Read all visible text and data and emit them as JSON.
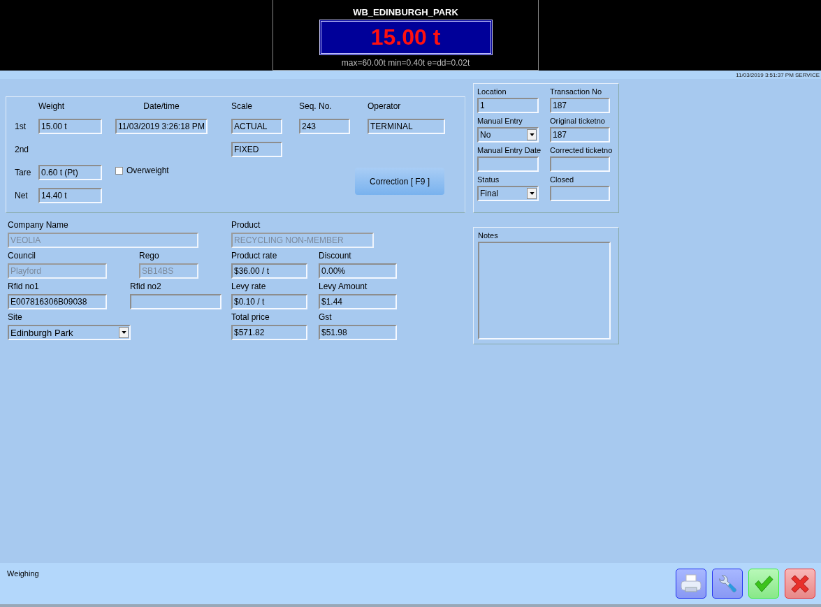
{
  "display": {
    "title": "WB_EDINBURGH_PARK",
    "weight": "15.00 t",
    "limits": "max=60.00t min=0.40t e=dd=0.02t"
  },
  "timestamp": "11/03/2019 3:51:37 PM  SERVICE",
  "weighing": {
    "headers": [
      "Weight",
      "Date/time",
      "Scale",
      "Seq. No.",
      "Operator"
    ],
    "first": {
      "label": "1st",
      "weight": "15.00  t",
      "datetime": "11/03/2019 3:26:18 PM",
      "scale": "ACTUAL",
      "seq": "243",
      "operator": "TERMINAL"
    },
    "second": {
      "label": "2nd",
      "scale": "FIXED"
    },
    "tare": {
      "label": "Tare",
      "value": "0.60  t (Pt)"
    },
    "overweight": {
      "label": "Overweight",
      "checked": false
    },
    "net": {
      "label": "Net",
      "value": "14.40  t"
    },
    "correction_button": "Correction  [ F9 ]"
  },
  "details": {
    "rows": [
      [
        {
          "label": "Company Name",
          "value": "VEOLIA",
          "kind": "text",
          "disabled": true
        },
        "",
        {
          "label": "Product",
          "value": "RECYCLING NON-MEMBER",
          "kind": "text",
          "disabled": true
        }
      ],
      [
        {
          "label": "Council",
          "value": "Playford",
          "kind": "text",
          "disabled": true
        },
        {
          "label": "Rego",
          "value": "SB14BS",
          "kind": "text",
          "disabled": true
        },
        {
          "label": "Product rate",
          "value": "$36.00 / t",
          "kind": "text",
          "disabled": false
        },
        {
          "label": "Discount",
          "value": "0.00%",
          "kind": "text",
          "disabled": false
        }
      ],
      [
        {
          "label": "Rfid no1",
          "value": "E007816306B09038",
          "kind": "text",
          "disabled": false
        },
        {
          "label": "Rfid no2",
          "kind": "text",
          "disabled": false
        },
        {
          "label": "Levy rate",
          "value": "$0.10 / t",
          "kind": "text",
          "disabled": false
        },
        {
          "label": "Levy Amount",
          "value": "$1.44",
          "kind": "text",
          "disabled": false
        }
      ],
      [
        {
          "label": "Site",
          "value": "Edinburgh Park",
          "kind": "select",
          "disabled": false
        },
        "",
        {
          "label": "Total price",
          "value": "$571.82",
          "kind": "text",
          "disabled": false
        },
        {
          "label": "Gst",
          "value": "$51.98",
          "kind": "text",
          "disabled": false
        }
      ]
    ]
  },
  "transaction": {
    "fields": [
      {
        "label": "Location",
        "value": "1",
        "kind": "text"
      },
      {
        "label": "Transaction No",
        "value": "187",
        "kind": "text"
      },
      {
        "label": "Manual Entry",
        "value": "No",
        "kind": "select"
      },
      {
        "label": "Original ticketno",
        "value": "187",
        "kind": "text"
      },
      {
        "label": "Manual Entry Date",
        "kind": "text"
      },
      {
        "label": "Corrected ticketno",
        "kind": "text"
      },
      {
        "label": "Status",
        "value": "Final",
        "kind": "select"
      },
      {
        "label": "Closed",
        "kind": "text"
      }
    ]
  },
  "notes": {
    "label": "Notes"
  },
  "footer": {
    "status": "Weighing",
    "buttons": [
      {
        "kind": "print"
      },
      {
        "kind": "tools"
      },
      {
        "kind": "confirm"
      },
      {
        "kind": "cancel"
      }
    ]
  }
}
